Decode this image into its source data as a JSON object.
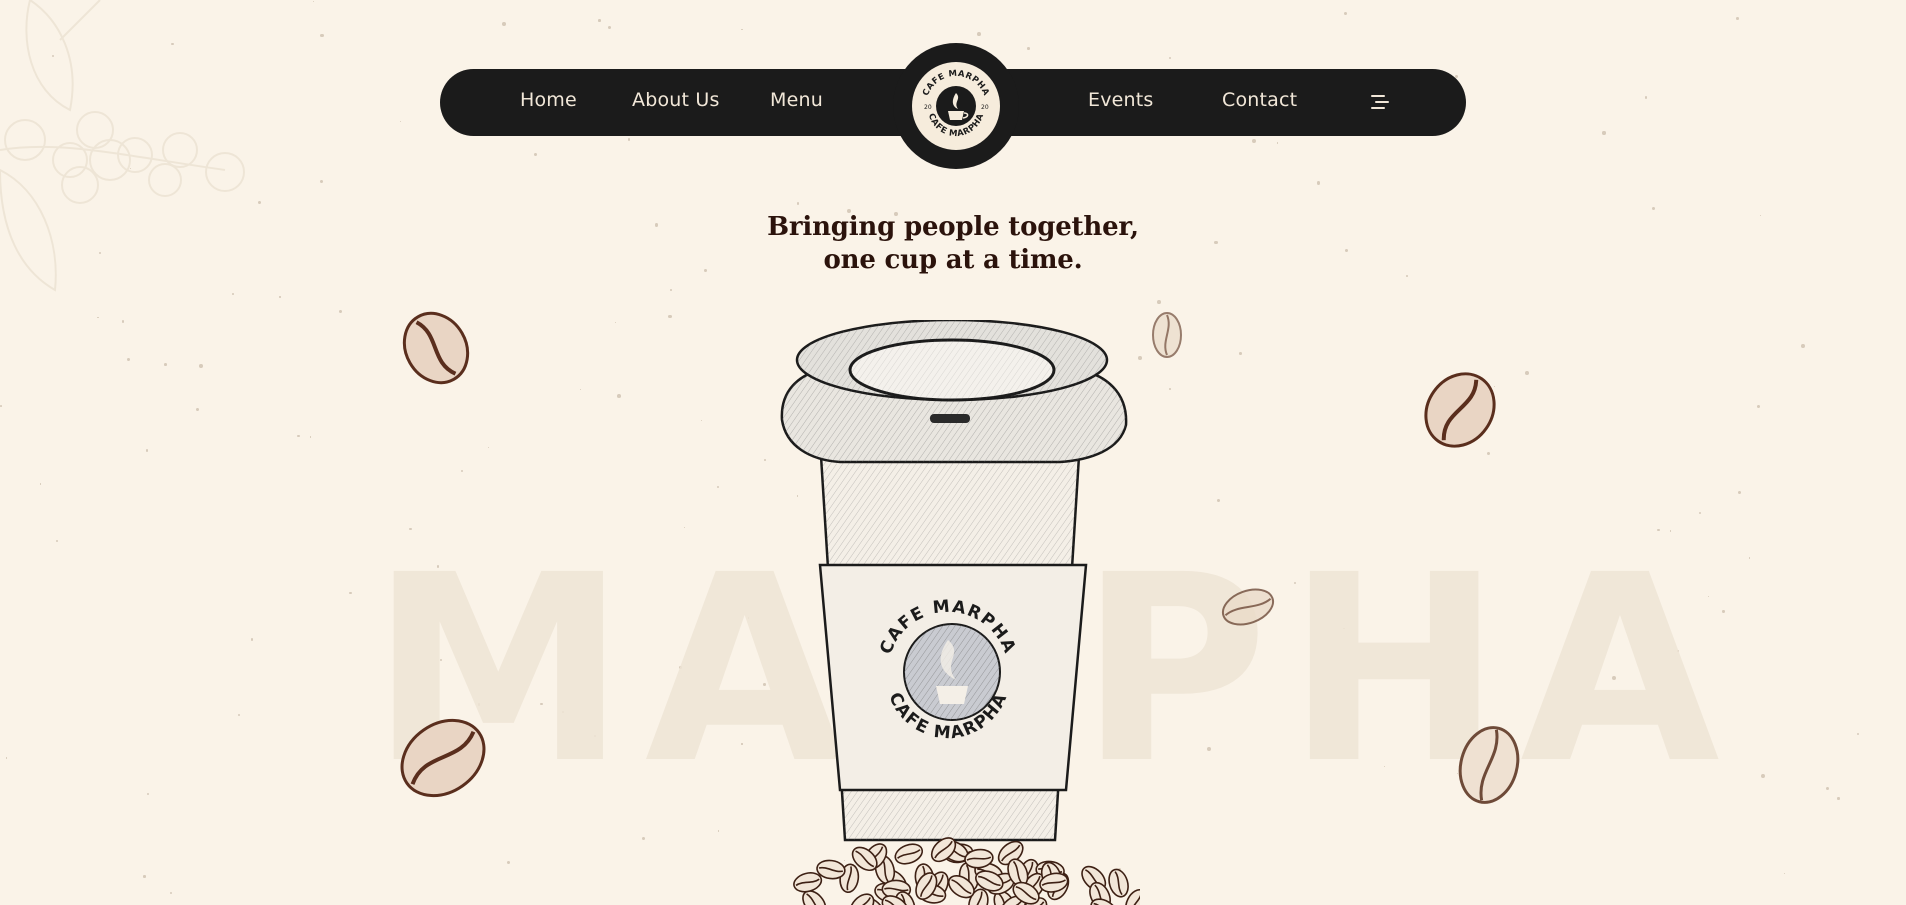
{
  "nav": {
    "left_items": [
      "Home",
      "About Us",
      "Menu"
    ],
    "right_items": [
      "Events",
      "Contact"
    ],
    "menu_icon": "hamburger-menu-icon"
  },
  "logo": {
    "text_top": "CAFE MARPHA",
    "text_bottom": "CAFE MARPHA",
    "num_left": "20",
    "num_right": "20"
  },
  "hero": {
    "headline_line1": "Bringing people together,",
    "headline_line2": "one cup at a time.",
    "watermark": "MARPHA"
  },
  "cup": {
    "sleeve_text_top": "CAFE MARPHA",
    "sleeve_text_bottom": "CAFE MARPHA"
  },
  "colors": {
    "background": "#faf3e8",
    "nav_bg": "#1b1b1b",
    "nav_text": "#f1e7d8",
    "headline": "#2b130c",
    "bean": "#5a2e1d"
  }
}
